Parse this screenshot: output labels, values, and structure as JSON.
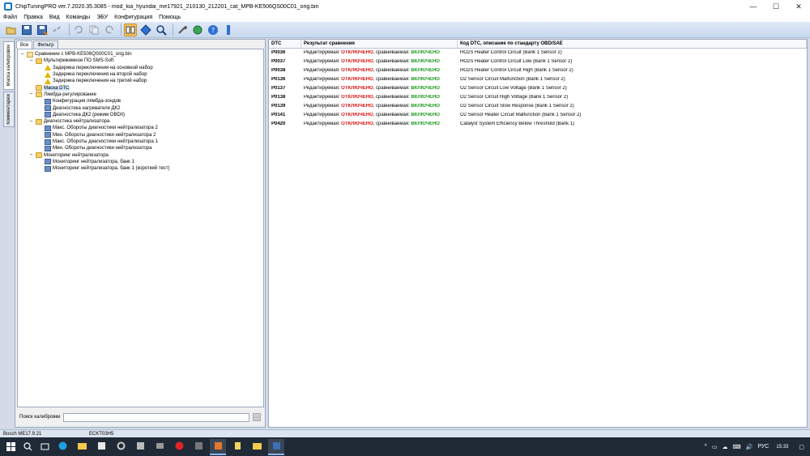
{
  "window": {
    "title": "ChipTuningPRO ver.7.2020.35.3085 - mod_kia_hyundai_me17921_210130_212201_cat_MPB-KE506QS00C01_orig.bin",
    "buttons": {
      "minimize": "—",
      "maximize": "☐",
      "close": "✕"
    }
  },
  "menu": [
    "Файл",
    "Правка",
    "Вид",
    "Команды",
    "ЭБУ",
    "Конфигурация",
    "Помощь"
  ],
  "toolbar": {
    "icons": [
      "open-icon",
      "save-icon",
      "save-as-icon",
      "link-icon",
      "undo-icon",
      "copy-icon",
      "redo-icon",
      "compare-icon",
      "navigate-icon",
      "search-zoom-icon",
      "tools-icon",
      "refresh-icon",
      "help-icon",
      "more-icon"
    ]
  },
  "vtabs": [
    "Маска калибровок",
    "Комментарии"
  ],
  "left_tabs": [
    "Все",
    "Фильтр"
  ],
  "tree": [
    {
      "level": 0,
      "exp": "−",
      "icon": "root",
      "label": "Сравнение с MPB-KE506QS00C01_orig.bin"
    },
    {
      "level": 1,
      "exp": "−",
      "icon": "folder",
      "label": "Мультирежимное ПО SMS-Soft"
    },
    {
      "level": 2,
      "exp": "",
      "icon": "warn",
      "label": "Задержка переключения на основной набор"
    },
    {
      "level": 2,
      "exp": "",
      "icon": "warn",
      "label": "Задержка переключения на второй набор"
    },
    {
      "level": 2,
      "exp": "",
      "icon": "warn",
      "label": "Задержка переключения на третий набор"
    },
    {
      "level": 1,
      "exp": "",
      "icon": "folder",
      "label": "Маска DTC",
      "selected": true
    },
    {
      "level": 1,
      "exp": "−",
      "icon": "folder",
      "label": "Лямбда-регулирование"
    },
    {
      "level": 2,
      "exp": "",
      "icon": "param",
      "label": "Конфигурация лямбда-зондов"
    },
    {
      "level": 2,
      "exp": "",
      "icon": "param",
      "label": "Диагностика нагревателя ДК2"
    },
    {
      "level": 2,
      "exp": "",
      "icon": "param",
      "label": "Диагностика ДК2 (режим OBDII)"
    },
    {
      "level": 1,
      "exp": "−",
      "icon": "folder",
      "label": "Диагностика нейтрализатора"
    },
    {
      "level": 2,
      "exp": "",
      "icon": "param",
      "label": "Макс. Обороты диагностики нейтрализатора 2"
    },
    {
      "level": 2,
      "exp": "",
      "icon": "param",
      "label": "Мин. Обороты диагностики нейтрализатора 2"
    },
    {
      "level": 2,
      "exp": "",
      "icon": "param",
      "label": "Макс. Обороты диагностики нейтрализатора 1"
    },
    {
      "level": 2,
      "exp": "",
      "icon": "param",
      "label": "Мин. Обороты диагностики нейтрализатора"
    },
    {
      "level": 1,
      "exp": "−",
      "icon": "folder",
      "label": "Мониторинг нейтрализатора"
    },
    {
      "level": 2,
      "exp": "",
      "icon": "param",
      "label": "Мониторинг нейтрализатора, банк 1"
    },
    {
      "level": 2,
      "exp": "",
      "icon": "param",
      "label": "Мониторинг нейтрализатора, банк 1 (короткий тест)"
    }
  ],
  "search": {
    "label": "Поиск калибровки",
    "value": "",
    "button": "…"
  },
  "table": {
    "headers": [
      "DTC",
      "Результат сравнения",
      "Код DTC, описание по стандарту OBD/SAE"
    ],
    "status_words": {
      "edited": "Редактируемая:",
      "off": "ОТКЛЮЧЕНО",
      "compared": "сравниваемая:",
      "on": "ВКЛЮЧЕНО"
    },
    "rows": [
      {
        "dtc": "P0036",
        "desc": "HO2S Heater Control Circuit (Bank 1 Sensor 2)"
      },
      {
        "dtc": "P0037",
        "desc": "HO2S Heater Control Circuit Low (Bank 1 Sensor 2)"
      },
      {
        "dtc": "P0038",
        "desc": "HO2S Heater Control Circuit High (Bank 1 Sensor 2)"
      },
      {
        "dtc": "P0136",
        "desc": "O2 Sensor Circuit Malfunction (Bank 1 Sensor 2)"
      },
      {
        "dtc": "P0137",
        "desc": "O2 Sensor Circuit Low Voltage (Bank 1 Sensor 2)"
      },
      {
        "dtc": "P0138",
        "desc": "O2 Sensor Circuit High Voltage (Bank 1 Sensor 2)"
      },
      {
        "dtc": "P0139",
        "desc": "O2 Sensor Circuit Slow Response (Bank 1 Sensor 2)"
      },
      {
        "dtc": "P0141",
        "desc": "O2 Sensor Heater Circuit Malfunction (Bank 1 Sensor 2)"
      },
      {
        "dtc": "P0420",
        "desc": "Catalyst System Efficiency Below Threshold (Bank 1)"
      }
    ]
  },
  "status": {
    "ecu": "Bosch ME17.9.21",
    "id": "ECKT03H5"
  },
  "taskbar": {
    "clock": "15:33",
    "tray": [
      "^",
      "▭",
      "☁",
      "⌨",
      "🔊",
      "РУС"
    ]
  },
  "colors": {
    "off": "#e01010",
    "on": "#1a9a1a",
    "toolbar": "#c7d8ee"
  }
}
